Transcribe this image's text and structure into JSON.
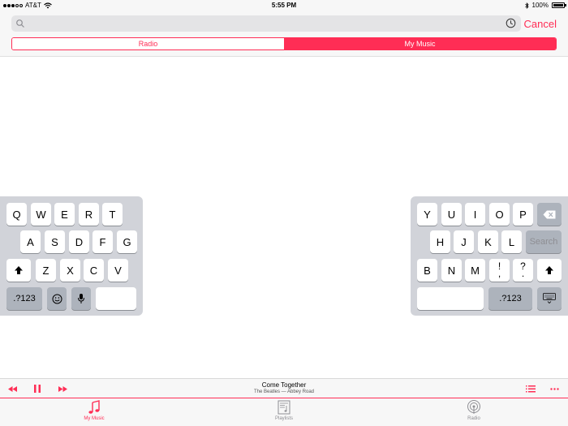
{
  "status_bar": {
    "carrier": "AT&T",
    "time": "5:55 PM",
    "battery": "100%"
  },
  "search": {
    "placeholder": "",
    "cancel_label": "Cancel"
  },
  "segments": [
    {
      "label": "Radio",
      "selected": false
    },
    {
      "label": "My Music",
      "selected": true
    }
  ],
  "keyboard": {
    "left_rows": [
      [
        "Q",
        "W",
        "E",
        "R",
        "T"
      ],
      [
        "A",
        "S",
        "D",
        "F",
        "G"
      ],
      [
        "Z",
        "X",
        "C",
        "V"
      ]
    ],
    "left_numbers_label": ".?123",
    "right_rows": [
      [
        "Y",
        "U",
        "I",
        "O",
        "P"
      ],
      [
        "H",
        "J",
        "K",
        "L"
      ],
      [
        "B",
        "N",
        "M"
      ]
    ],
    "punct_1": {
      "top": "!",
      "bottom": ","
    },
    "punct_2": {
      "top": "?",
      "bottom": "."
    },
    "search_key": "Search",
    "right_numbers_label": ".?123"
  },
  "now_playing": {
    "title": "Come Together",
    "subtitle": "The Beatles — Abbey Road"
  },
  "tabs": [
    {
      "label": "My Music",
      "icon": "music-note-icon",
      "active": true
    },
    {
      "label": "Playlists",
      "icon": "playlists-icon",
      "active": false
    },
    {
      "label": "Radio",
      "icon": "radio-icon",
      "active": false
    }
  ],
  "colors": {
    "accent": "#ff2d55",
    "keyboard_bg": "#d1d3d9",
    "func_key": "#adb3bc"
  }
}
